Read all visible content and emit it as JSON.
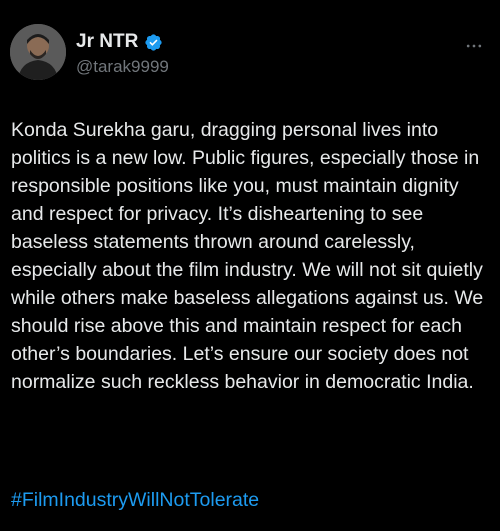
{
  "author": {
    "display_name": "Jr NTR",
    "handle": "@tarak9999",
    "verified": true,
    "verified_color": "#1d9bf0"
  },
  "tweet": {
    "text": "Konda Surekha garu, dragging personal lives into politics is a new low. Public figures, especially those in responsible positions like you, must maintain dignity and respect for privacy. It’s disheartening to see baseless statements thrown around carelessly, especially about the film industry. We will not sit quietly while others make baseless allegations against us. We should rise above this and maintain respect for each other’s boundaries. Let’s ensure our society does not normalize such reckless behavior in democratic India.",
    "hashtag": "#FilmIndustryWillNotTolerate"
  },
  "icons": {
    "avatar": "profile-photo",
    "verified": "verified-badge-icon",
    "more": "more-options-icon"
  },
  "colors": {
    "background": "#000000",
    "text": "#e7e9ea",
    "secondary_text": "#71767b",
    "link": "#1d9bf0"
  }
}
